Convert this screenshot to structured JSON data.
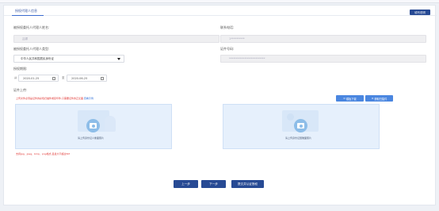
{
  "header": {
    "title": "授权代理人信息",
    "top_button": "填写说明"
  },
  "form": {
    "agent_name_label": "被授权委托人代理人姓名:",
    "agent_name_value": "吕娜",
    "contact_phone_label": "联系电话:",
    "contact_phone_value": "1**********",
    "agent_type_label": "被授权委托人代理人类型:",
    "agent_type_value": "中华人民共和国居民身份证",
    "id_number_label": "证件号码:",
    "id_number_value": "**************************",
    "auth_period_label": "授权期限:",
    "start_prefix": "从",
    "start_date": "2020-01-25",
    "end_prefix": "至",
    "end_date": "2020-06-25"
  },
  "upload": {
    "section_label": "证件上传:",
    "hint": "上传文件必须是证件的彩色扫描件或复印件,只需要证件的正反面,",
    "hint_link": "查看示例",
    "btn_download": "模板下载",
    "btn_scan": "获取扫描件",
    "front_caption": "请上传身份证人像面照片",
    "back_caption": "请上传身份证国徽面照片",
    "bottom_hint": "支持jpg、jpeg、bmp、png格式,且最大不超过5M"
  },
  "nav": {
    "prev": "上一步",
    "next": "下一步",
    "submit": "提交并认证授权"
  }
}
